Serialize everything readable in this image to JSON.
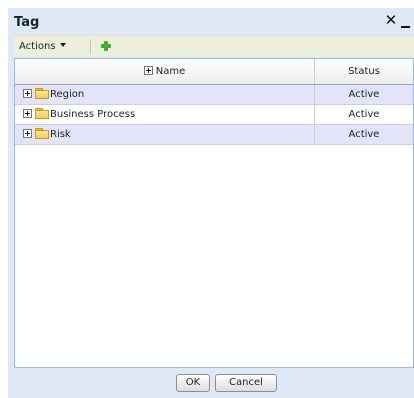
{
  "window": {
    "title": "Tag",
    "close_icon": "close-icon",
    "minimize_icon": "minimize-icon"
  },
  "toolbar": {
    "actions_label": "Actions",
    "actions_icon": "dropdown-arrow-icon",
    "add_icon": "add-icon"
  },
  "grid": {
    "columns": {
      "name": "Name",
      "status": "Status"
    },
    "rows": [
      {
        "name": "Region",
        "status": "Active"
      },
      {
        "name": "Business Process",
        "status": "Active"
      },
      {
        "name": "Risk",
        "status": "Active"
      }
    ]
  },
  "footer": {
    "ok_label": "OK",
    "cancel_label": "Cancel"
  },
  "colors": {
    "window_bg": "#dfe8f6",
    "toolbar_bg": "#edeedb",
    "alt_row_bg": "#e4e4f8",
    "grid_border": "#99bbe8",
    "add_icon_green": "#3fae28",
    "folder_yellow": "#f4cb55"
  }
}
